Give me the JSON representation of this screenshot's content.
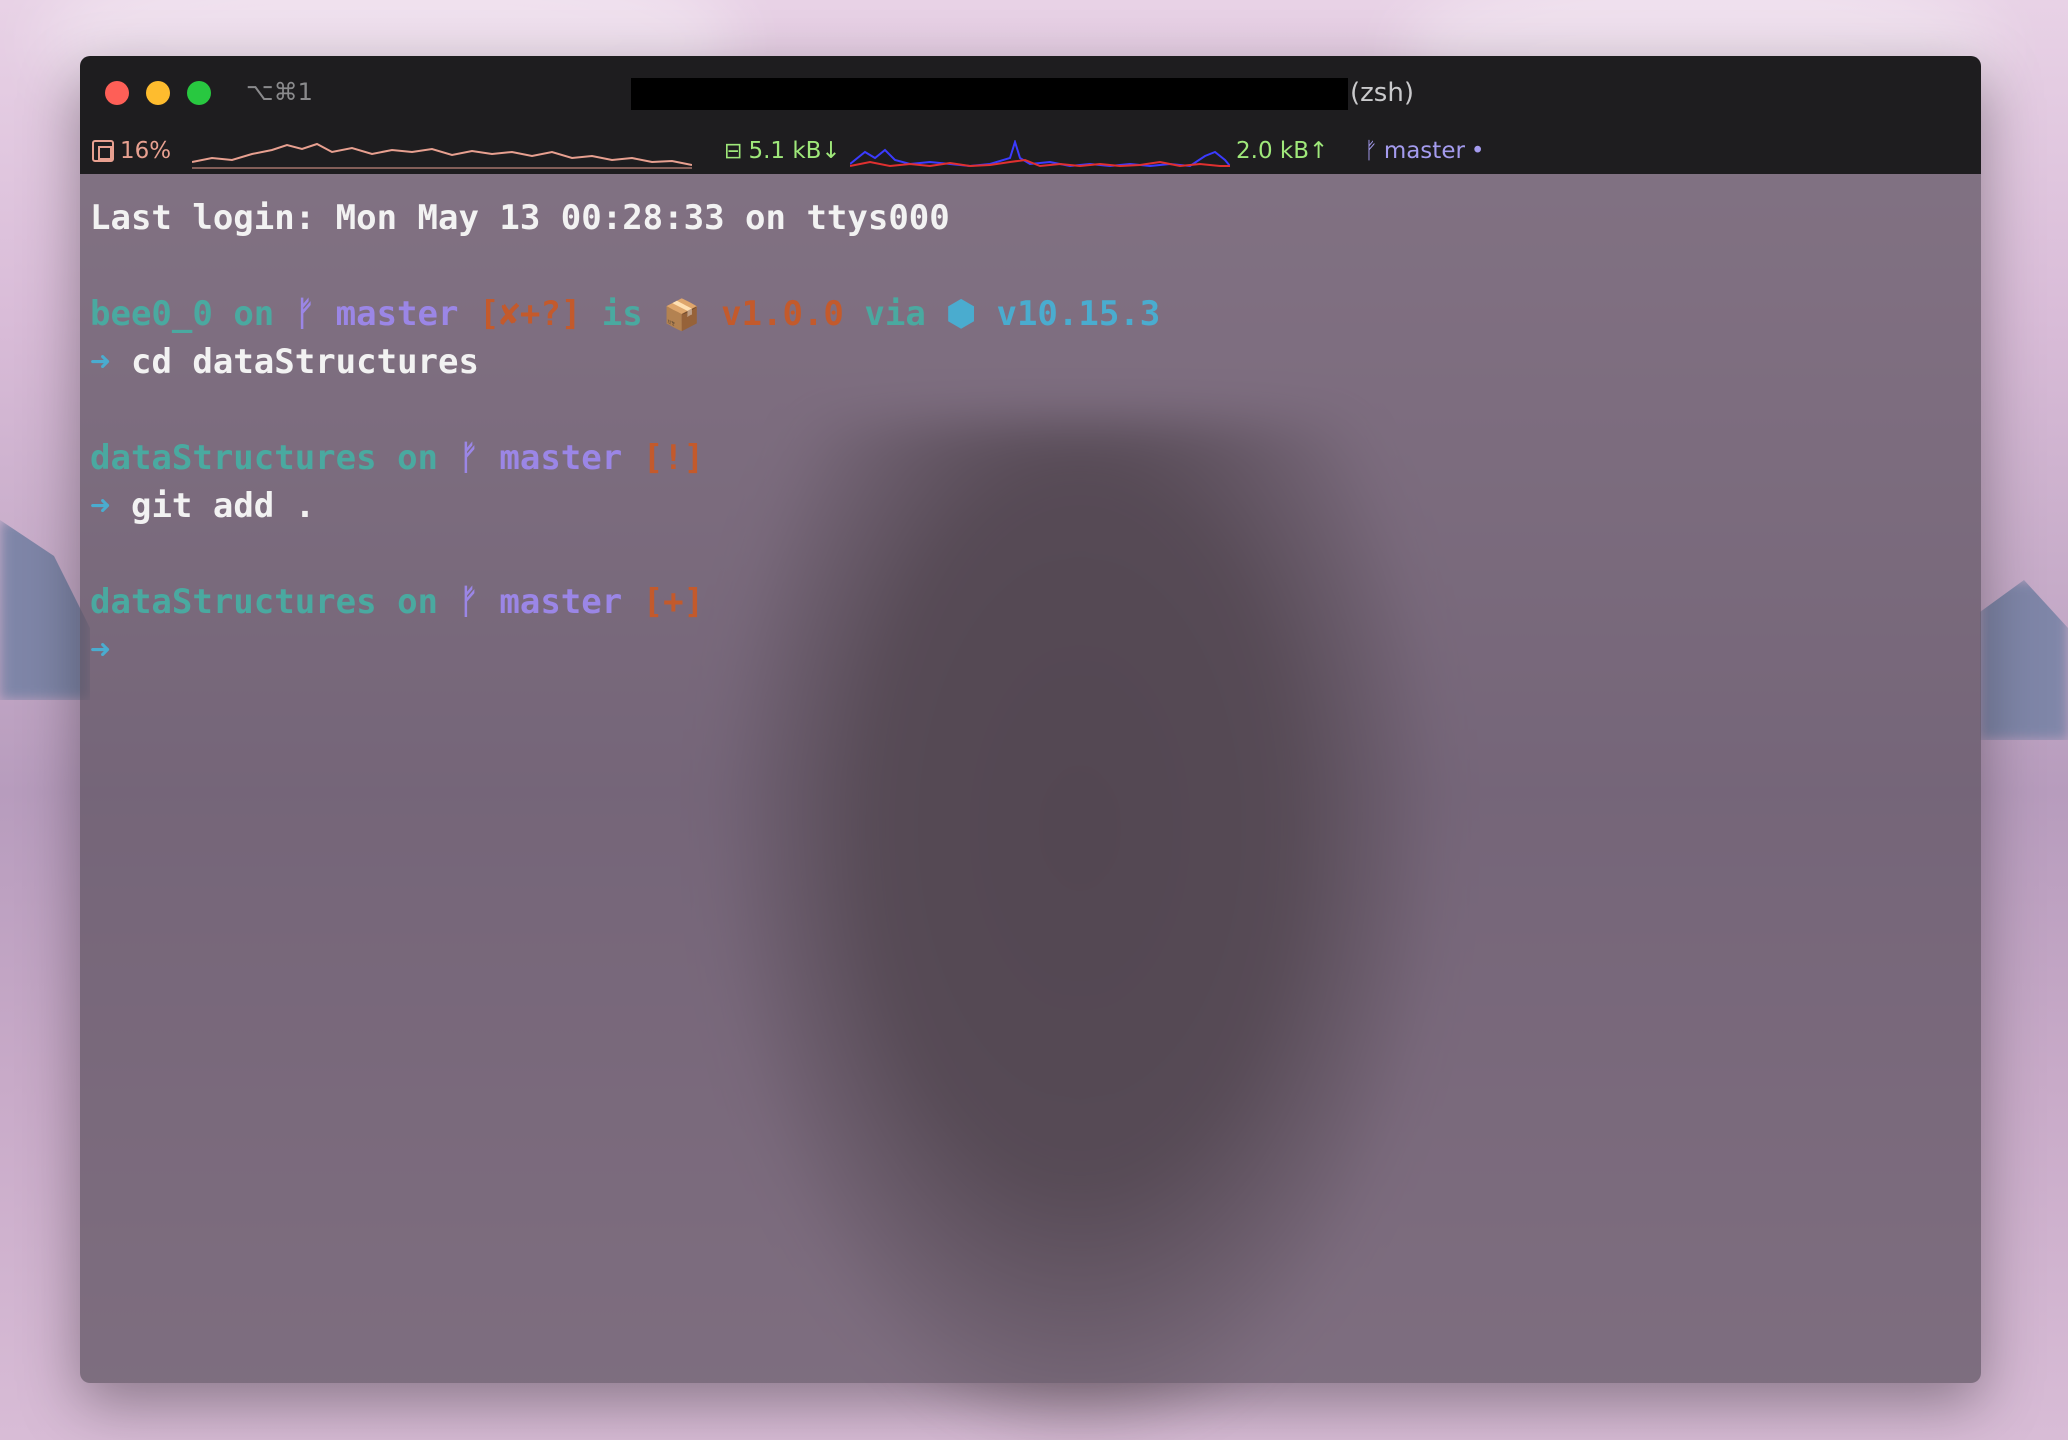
{
  "window": {
    "shortcut": "⌥⌘1",
    "title": "(zsh)"
  },
  "statusbar": {
    "cpu": "16%",
    "net_down": "5.1 kB↓",
    "net_up": "2.0 kB↑",
    "git_branch": "master",
    "git_dot": "•"
  },
  "terminal": {
    "last_login": "Last login: Mon May 13 00:28:33 on ttys000",
    "prompt1": {
      "dir": "bee0_0",
      "on": "on",
      "branch_icon": "",
      "branch": "master",
      "status": "[✘+?]",
      "is": "is",
      "pkg_icon": "📦",
      "pkg_version": "v1.0.0",
      "via": "via",
      "node_icon": "⬢",
      "node_version": "v10.15.3"
    },
    "cmd1": {
      "arrow": "➜",
      "text": "cd dataStructures"
    },
    "prompt2": {
      "dir": "dataStructures",
      "on": "on",
      "branch_icon": "",
      "branch": "master",
      "status": "[!]"
    },
    "cmd2": {
      "arrow": "➜",
      "text": "git add ."
    },
    "prompt3": {
      "dir": "dataStructures",
      "on": "on",
      "branch_icon": "",
      "branch": "master",
      "status": "[+]"
    },
    "cmd3": {
      "arrow": "➜",
      "text": ""
    }
  },
  "colors": {
    "teal": "#4aa9a0",
    "purple": "#9b86e6",
    "orange": "#c35a2c",
    "cyan": "#4aaccf"
  }
}
